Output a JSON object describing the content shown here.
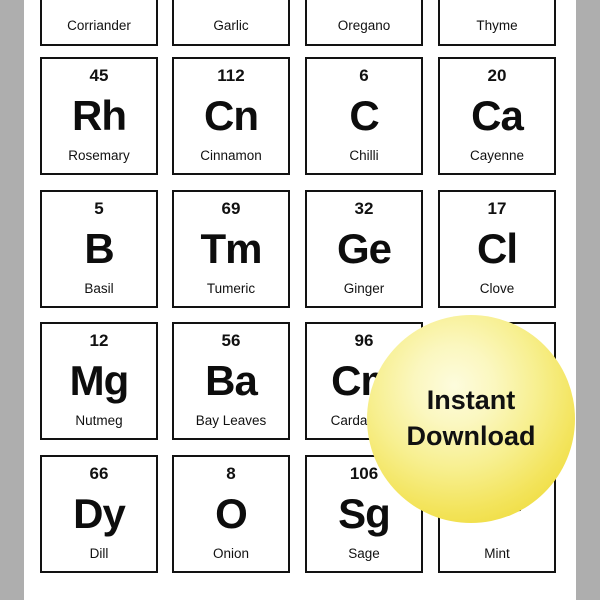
{
  "image": {
    "background_color": "#aeaeae",
    "sheet_color": "#ffffff",
    "tile_border_color": "#121212"
  },
  "badge": {
    "line1": "Instant",
    "line2": "Download",
    "color": "#f3e45c",
    "text_color": "#111111"
  },
  "rows": [
    {
      "cells": [
        {
          "number": "",
          "symbol": "",
          "name": "Corriander"
        },
        {
          "number": "",
          "symbol": "",
          "name": "Garlic"
        },
        {
          "number": "",
          "symbol": "",
          "name": "Oregano"
        },
        {
          "number": "",
          "symbol": "",
          "name": "Thyme"
        }
      ]
    },
    {
      "cells": [
        {
          "number": "45",
          "symbol": "Rh",
          "name": "Rosemary"
        },
        {
          "number": "112",
          "symbol": "Cn",
          "name": "Cinnamon"
        },
        {
          "number": "6",
          "symbol": "C",
          "name": "Chilli"
        },
        {
          "number": "20",
          "symbol": "Ca",
          "name": "Cayenne"
        }
      ]
    },
    {
      "cells": [
        {
          "number": "5",
          "symbol": "B",
          "name": "Basil"
        },
        {
          "number": "69",
          "symbol": "Tm",
          "name": "Tumeric"
        },
        {
          "number": "32",
          "symbol": "Ge",
          "name": "Ginger"
        },
        {
          "number": "17",
          "symbol": "Cl",
          "name": "Clove"
        }
      ]
    },
    {
      "cells": [
        {
          "number": "12",
          "symbol": "Mg",
          "name": "Nutmeg"
        },
        {
          "number": "56",
          "symbol": "Ba",
          "name": "Bay Leaves"
        },
        {
          "number": "96",
          "symbol": "Cm",
          "name": "Cardamom"
        },
        {
          "number": "",
          "symbol": "",
          "name": ""
        }
      ]
    },
    {
      "cells": [
        {
          "number": "66",
          "symbol": "Dy",
          "name": "Dill"
        },
        {
          "number": "8",
          "symbol": "O",
          "name": "Onion"
        },
        {
          "number": "106",
          "symbol": "Sg",
          "name": "Sage"
        },
        {
          "number": "",
          "symbol": "Mt",
          "name": "Mint"
        }
      ]
    }
  ]
}
